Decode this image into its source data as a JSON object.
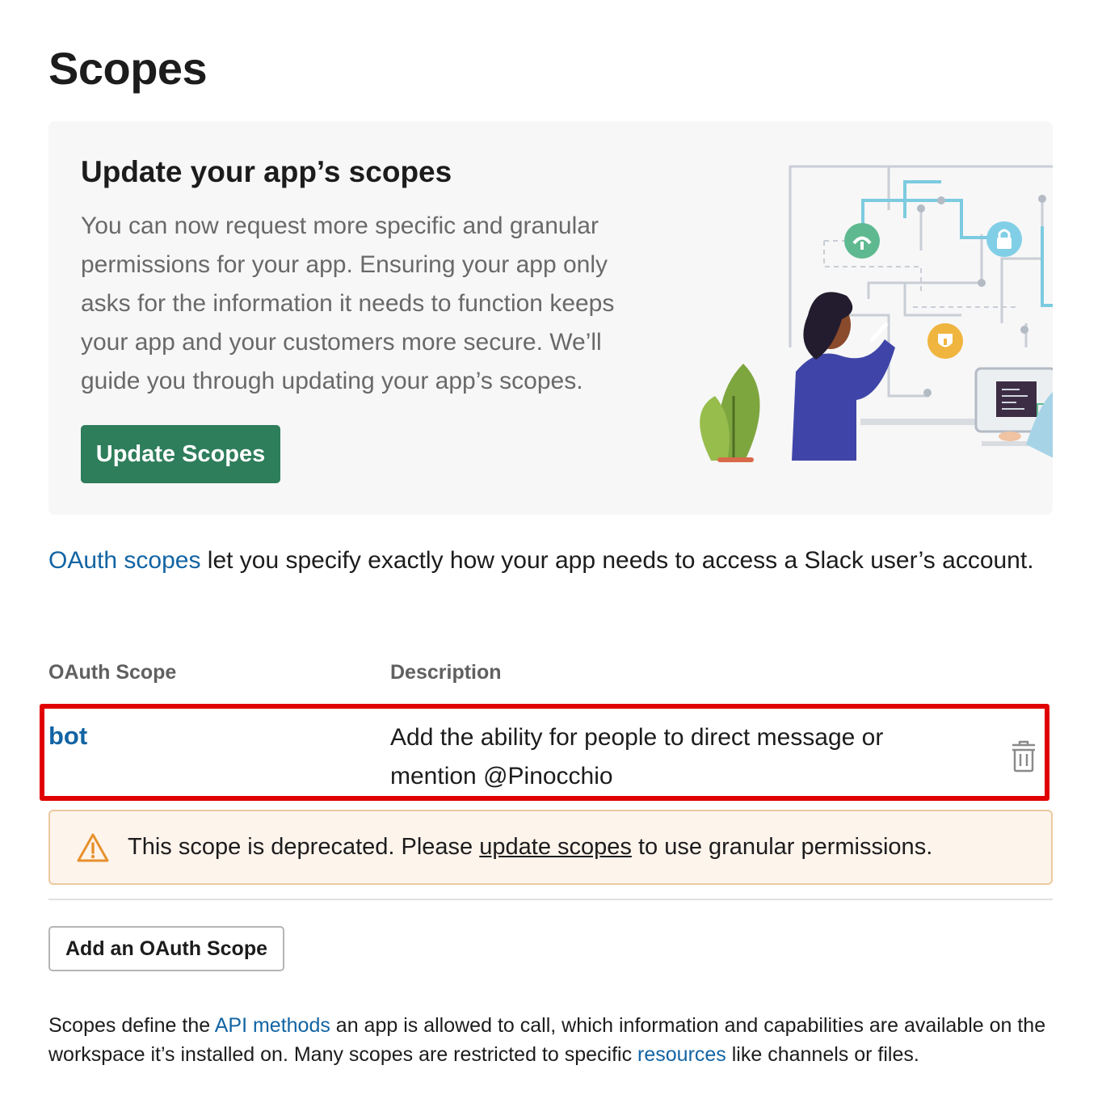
{
  "page": {
    "title": "Scopes"
  },
  "banner": {
    "title": "Update your app’s scopes",
    "text": "You can now request more specific and granular permissions for your app. Ensuring your app only asks for the information it needs to function keeps your app and your customers more secure. We’ll guide you through updating your app’s scopes.",
    "button_label": "Update Scopes",
    "illustration_icon": "people-at-computers-illustration"
  },
  "intro": {
    "link_text": "OAuth scopes",
    "text": " let you specify exactly how your app needs to access a Slack user’s account."
  },
  "table": {
    "headers": {
      "scope": "OAuth Scope",
      "description": "Description"
    },
    "rows": [
      {
        "scope": "bot",
        "description": "Add the ability for people to direct message or mention @Pinocchio",
        "delete_icon": "trash-icon",
        "highlight_color": "#e00000"
      }
    ]
  },
  "warning": {
    "icon": "warning-triangle-icon",
    "text_before": "This scope is deprecated. Please ",
    "link_text": "update scopes",
    "text_after": " to use granular permissions."
  },
  "add_button_label": "Add an OAuth Scope",
  "footer": {
    "part1": "Scopes define the ",
    "link1": "API methods",
    "part2": " an app is allowed to call, which information and capabilities are available on the workspace it’s installed on. Many scopes are restricted to specific ",
    "link2": "resources",
    "part3": " like channels or files."
  },
  "colors": {
    "primary_button": "#2e7d5b",
    "link": "#1264a3",
    "warning_bg": "#fdf4ec",
    "warning_border": "#ecc9a0",
    "warning_icon": "#e8912d"
  }
}
